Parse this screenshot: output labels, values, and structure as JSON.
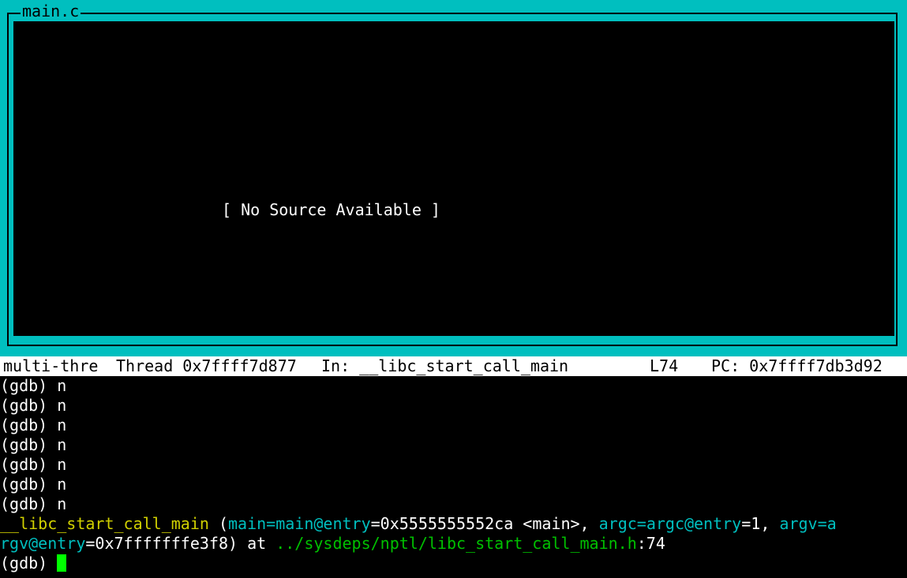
{
  "source_window": {
    "title": "main.c",
    "message": "[ No Source Available ]"
  },
  "status_bar": {
    "target": "multi-thre",
    "thread": "Thread 0x7ffff7d877",
    "function": "In: __libc_start_call_main",
    "line": "L74",
    "pc": "PC: 0x7ffff7db3d92"
  },
  "console": {
    "history": [
      {
        "prompt": "(gdb)",
        "command": "n"
      },
      {
        "prompt": "(gdb)",
        "command": "n"
      },
      {
        "prompt": "(gdb)",
        "command": "n"
      },
      {
        "prompt": "(gdb)",
        "command": "n"
      },
      {
        "prompt": "(gdb)",
        "command": "n"
      },
      {
        "prompt": "(gdb)",
        "command": "n"
      },
      {
        "prompt": "(gdb)",
        "command": "n"
      }
    ],
    "frame": {
      "func": "__libc_start_call_main",
      "paren_open": " (",
      "arg1_name": "main=main@entry",
      "arg1_value": "=0x5555555552ca <main>, ",
      "arg2_name": "argc=argc@entry",
      "arg2_value": "=1, ",
      "arg3_name_part1": "argv=a",
      "arg3_name_part2": "rgv@entry",
      "arg3_value": "=0x7fffffffe3f8) at ",
      "file": "../sysdeps/nptl/libc_start_call_main.h",
      "line_suffix": ":74"
    },
    "prompt": "(gdb) "
  },
  "colors": {
    "tui_border": "#00bfbf",
    "function_name": "#d0d000",
    "argument_name": "#00bfbf",
    "file_path": "#00c000",
    "cursor": "#00ff00"
  }
}
